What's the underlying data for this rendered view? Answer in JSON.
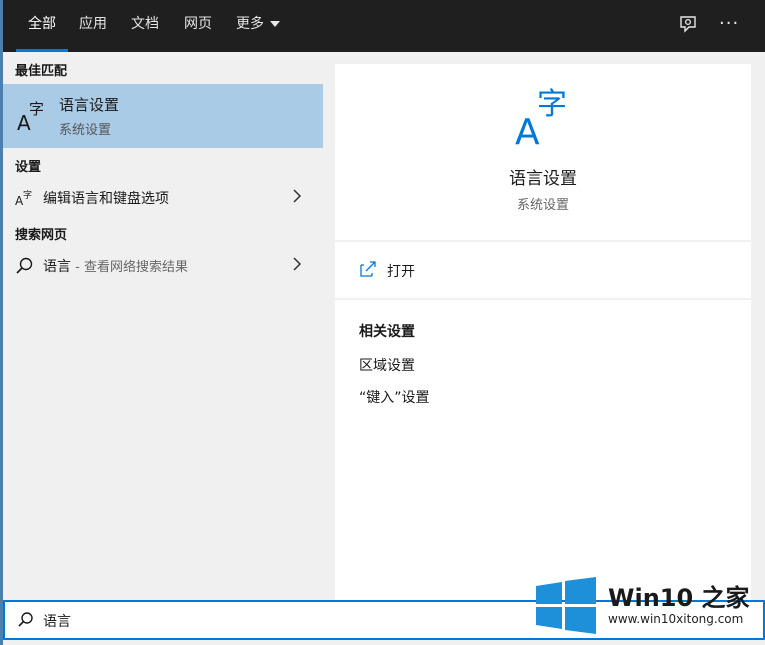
{
  "tabs": [
    {
      "label": "全部"
    },
    {
      "label": "应用"
    },
    {
      "label": "文档"
    },
    {
      "label": "网页"
    },
    {
      "label": "更多"
    }
  ],
  "topbar_icons": [
    "feedback-icon",
    "more-icon"
  ],
  "more_glyph": "···",
  "left": {
    "best_match_heading": "最佳匹配",
    "best_match": {
      "title": "语言设置",
      "subtitle": "系统设置",
      "icon": "language-icon"
    },
    "settings_heading": "设置",
    "settings_item": {
      "label": "编辑语言和键盘选项"
    },
    "web_heading": "搜索网页",
    "web_item": {
      "label": "语言",
      "suffix": " - 查看网络搜索结果"
    }
  },
  "right": {
    "title": "语言设置",
    "subtitle": "系统设置",
    "open_label": "打开",
    "related_heading": "相关设置",
    "related_links": [
      "区域设置",
      "“键入”设置"
    ]
  },
  "search": {
    "value": "语言"
  },
  "watermark": {
    "title": "Win10 之家",
    "url": "www.win10xitong.com"
  },
  "colors": {
    "accent": "#0078d7",
    "selected": "#a9cbe6",
    "topbar": "#1f1f1f"
  }
}
